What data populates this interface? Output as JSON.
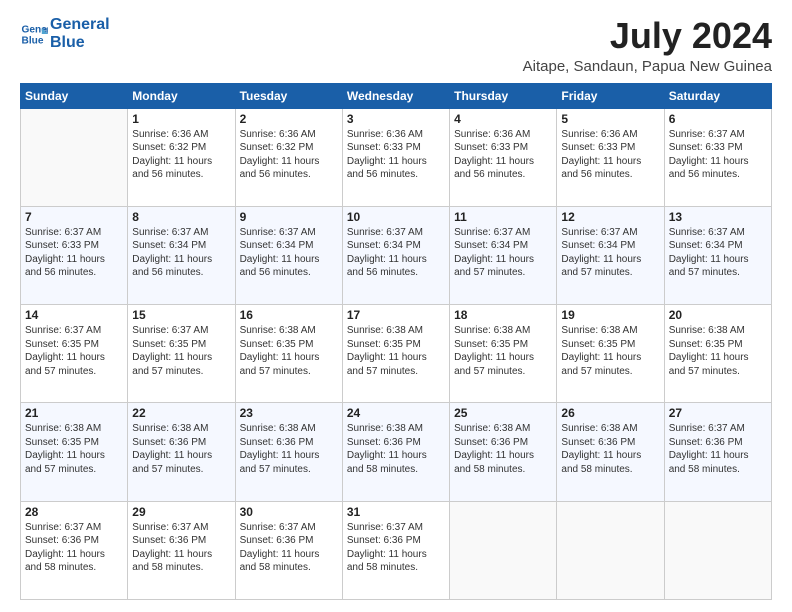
{
  "logo": {
    "line1": "General",
    "line2": "Blue"
  },
  "title": "July 2024",
  "subtitle": "Aitape, Sandaun, Papua New Guinea",
  "headers": [
    "Sunday",
    "Monday",
    "Tuesday",
    "Wednesday",
    "Thursday",
    "Friday",
    "Saturday"
  ],
  "weeks": [
    [
      {
        "day": "",
        "info": ""
      },
      {
        "day": "1",
        "info": "Sunrise: 6:36 AM\nSunset: 6:32 PM\nDaylight: 11 hours\nand 56 minutes."
      },
      {
        "day": "2",
        "info": "Sunrise: 6:36 AM\nSunset: 6:32 PM\nDaylight: 11 hours\nand 56 minutes."
      },
      {
        "day": "3",
        "info": "Sunrise: 6:36 AM\nSunset: 6:33 PM\nDaylight: 11 hours\nand 56 minutes."
      },
      {
        "day": "4",
        "info": "Sunrise: 6:36 AM\nSunset: 6:33 PM\nDaylight: 11 hours\nand 56 minutes."
      },
      {
        "day": "5",
        "info": "Sunrise: 6:36 AM\nSunset: 6:33 PM\nDaylight: 11 hours\nand 56 minutes."
      },
      {
        "day": "6",
        "info": "Sunrise: 6:37 AM\nSunset: 6:33 PM\nDaylight: 11 hours\nand 56 minutes."
      }
    ],
    [
      {
        "day": "7",
        "info": "Sunrise: 6:37 AM\nSunset: 6:33 PM\nDaylight: 11 hours\nand 56 minutes."
      },
      {
        "day": "8",
        "info": "Sunrise: 6:37 AM\nSunset: 6:34 PM\nDaylight: 11 hours\nand 56 minutes."
      },
      {
        "day": "9",
        "info": "Sunrise: 6:37 AM\nSunset: 6:34 PM\nDaylight: 11 hours\nand 56 minutes."
      },
      {
        "day": "10",
        "info": "Sunrise: 6:37 AM\nSunset: 6:34 PM\nDaylight: 11 hours\nand 56 minutes."
      },
      {
        "day": "11",
        "info": "Sunrise: 6:37 AM\nSunset: 6:34 PM\nDaylight: 11 hours\nand 57 minutes."
      },
      {
        "day": "12",
        "info": "Sunrise: 6:37 AM\nSunset: 6:34 PM\nDaylight: 11 hours\nand 57 minutes."
      },
      {
        "day": "13",
        "info": "Sunrise: 6:37 AM\nSunset: 6:34 PM\nDaylight: 11 hours\nand 57 minutes."
      }
    ],
    [
      {
        "day": "14",
        "info": "Sunrise: 6:37 AM\nSunset: 6:35 PM\nDaylight: 11 hours\nand 57 minutes."
      },
      {
        "day": "15",
        "info": "Sunrise: 6:37 AM\nSunset: 6:35 PM\nDaylight: 11 hours\nand 57 minutes."
      },
      {
        "day": "16",
        "info": "Sunrise: 6:38 AM\nSunset: 6:35 PM\nDaylight: 11 hours\nand 57 minutes."
      },
      {
        "day": "17",
        "info": "Sunrise: 6:38 AM\nSunset: 6:35 PM\nDaylight: 11 hours\nand 57 minutes."
      },
      {
        "day": "18",
        "info": "Sunrise: 6:38 AM\nSunset: 6:35 PM\nDaylight: 11 hours\nand 57 minutes."
      },
      {
        "day": "19",
        "info": "Sunrise: 6:38 AM\nSunset: 6:35 PM\nDaylight: 11 hours\nand 57 minutes."
      },
      {
        "day": "20",
        "info": "Sunrise: 6:38 AM\nSunset: 6:35 PM\nDaylight: 11 hours\nand 57 minutes."
      }
    ],
    [
      {
        "day": "21",
        "info": "Sunrise: 6:38 AM\nSunset: 6:35 PM\nDaylight: 11 hours\nand 57 minutes."
      },
      {
        "day": "22",
        "info": "Sunrise: 6:38 AM\nSunset: 6:36 PM\nDaylight: 11 hours\nand 57 minutes."
      },
      {
        "day": "23",
        "info": "Sunrise: 6:38 AM\nSunset: 6:36 PM\nDaylight: 11 hours\nand 57 minutes."
      },
      {
        "day": "24",
        "info": "Sunrise: 6:38 AM\nSunset: 6:36 PM\nDaylight: 11 hours\nand 58 minutes."
      },
      {
        "day": "25",
        "info": "Sunrise: 6:38 AM\nSunset: 6:36 PM\nDaylight: 11 hours\nand 58 minutes."
      },
      {
        "day": "26",
        "info": "Sunrise: 6:38 AM\nSunset: 6:36 PM\nDaylight: 11 hours\nand 58 minutes."
      },
      {
        "day": "27",
        "info": "Sunrise: 6:37 AM\nSunset: 6:36 PM\nDaylight: 11 hours\nand 58 minutes."
      }
    ],
    [
      {
        "day": "28",
        "info": "Sunrise: 6:37 AM\nSunset: 6:36 PM\nDaylight: 11 hours\nand 58 minutes."
      },
      {
        "day": "29",
        "info": "Sunrise: 6:37 AM\nSunset: 6:36 PM\nDaylight: 11 hours\nand 58 minutes."
      },
      {
        "day": "30",
        "info": "Sunrise: 6:37 AM\nSunset: 6:36 PM\nDaylight: 11 hours\nand 58 minutes."
      },
      {
        "day": "31",
        "info": "Sunrise: 6:37 AM\nSunset: 6:36 PM\nDaylight: 11 hours\nand 58 minutes."
      },
      {
        "day": "",
        "info": ""
      },
      {
        "day": "",
        "info": ""
      },
      {
        "day": "",
        "info": ""
      }
    ]
  ]
}
